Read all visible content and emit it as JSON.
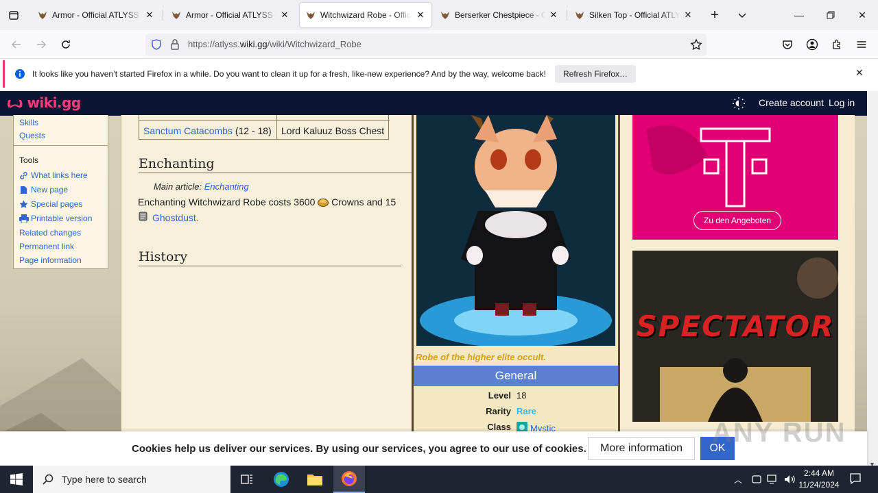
{
  "browser": {
    "tabs": [
      {
        "title": "Armor - Official ATLYSS Wiki",
        "active": false
      },
      {
        "title": "Armor - Official ATLYSS Wiki",
        "active": false
      },
      {
        "title": "Witchwizard Robe - Official ATLYSS Wiki",
        "active": true
      },
      {
        "title": "Berserker Chestpiece - Official ATLYSS Wiki",
        "active": false
      },
      {
        "title": "Silken Top - Official ATLYSS Wiki",
        "active": false
      }
    ],
    "url_prefix": "https://atlyss.",
    "url_domain": "wiki.gg",
    "url_path": "/wiki/Witchwizard_Robe",
    "notification": {
      "message": "It looks like you haven’t started Firefox in a while. Do you want to clean it up for a fresh, like-new experience? And by the way, welcome back!",
      "button": "Refresh Firefox…"
    }
  },
  "site": {
    "logo": "wiki.gg",
    "create_account": "Create account",
    "log_in": "Log in"
  },
  "sidebar": {
    "nav": [
      "Skills",
      "Quests"
    ],
    "tools_heading": "Tools",
    "tools": [
      {
        "label": "What links here",
        "icon": "link-icon"
      },
      {
        "label": "New page",
        "icon": "new-page-icon"
      },
      {
        "label": "Special pages",
        "icon": "star-icon"
      },
      {
        "label": "Printable version",
        "icon": "printer-icon"
      },
      {
        "label": "Related changes",
        "icon": ""
      },
      {
        "label": "Permanent link",
        "icon": ""
      },
      {
        "label": "Page information",
        "icon": ""
      }
    ]
  },
  "content": {
    "drop_table_row": {
      "location": "Sanctum Catacombs",
      "level": "(12 - 18)",
      "source": "Lord Kaluuz Boss Chest"
    },
    "enchanting_heading": "Enchanting",
    "main_article_label": "Main article:",
    "main_article_link": "Enchanting",
    "enchant_text_1": "Enchanting Witchwizard Robe costs 3600",
    "enchant_currency": "Crowns and 15",
    "enchant_material": "Ghostdust.",
    "history_heading": "History"
  },
  "infobox": {
    "caption": "Robe of the higher elite occult.",
    "section_title": "General",
    "rows": [
      {
        "key": "Level",
        "value": "18"
      },
      {
        "key": "Rarity",
        "value": "Rare"
      },
      {
        "key": "Class",
        "value": "Mystic"
      }
    ]
  },
  "ads": {
    "telekom_cta": "Zu den Angeboten",
    "spectator_title": "SPECTATOR"
  },
  "cookie": {
    "text": "Cookies help us deliver our services. By using our services, you agree to our use of cookies.",
    "more": "More information",
    "ok": "OK"
  },
  "watermark": "ANY RUN",
  "taskbar": {
    "search_placeholder": "Type here to search",
    "time": "2:44 AM",
    "date": "11/24/2024"
  },
  "colors": {
    "infobox_header": "#5b7fd1",
    "caption": "#d4a017",
    "rarity": "#3fb7e8",
    "logo": "#ff3c78",
    "telekom": "#e20074"
  }
}
